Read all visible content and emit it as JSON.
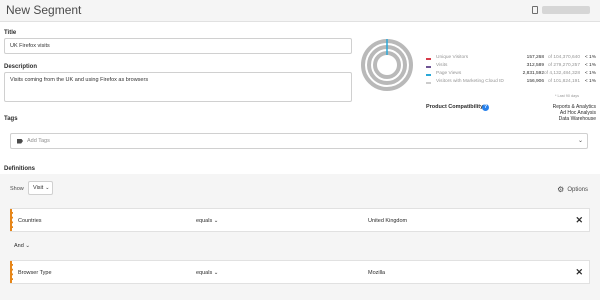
{
  "header": {
    "title": "New Segment",
    "username": ""
  },
  "form": {
    "title_label": "Title",
    "title_value": "UK Firefox visits",
    "description_label": "Description",
    "description_value": "Visits coming from the UK and using Firefox as browsers",
    "tags_label": "Tags",
    "tags_placeholder": "Add Tags"
  },
  "summary": {
    "metrics": [
      {
        "label": "Unique Visitors",
        "value": "157,268",
        "of": "of 104,370,640",
        "pct": "< 1%",
        "color": "#d73a49"
      },
      {
        "label": "Visits",
        "value": "312,589",
        "of": "of 279,270,257",
        "pct": "< 1%",
        "color": "#6e5494"
      },
      {
        "label": "Page Views",
        "value": "2,831,592",
        "of": "of 4,132,484,328",
        "pct": "< 1%",
        "color": "#2aa8d8"
      },
      {
        "label": "Visitors with Marketing Cloud ID",
        "value": "156,906",
        "of": "of 101,824,191",
        "pct": "< 1%",
        "color": "#cccccc"
      }
    ],
    "period_note": "* Last 90 days",
    "donut_ring_color": "#b9b9b9",
    "donut_highlight_color": "#2aa8d8"
  },
  "compatibility": {
    "label": "Product Compatibility",
    "products": [
      "Reports & Analytics",
      "Ad Hoc Analysis",
      "Data Warehouse"
    ]
  },
  "definitions": {
    "label": "Definitions",
    "show_label": "Show",
    "container": "Visit",
    "options_label": "Options",
    "and_label": "And",
    "accent_color": "#e68619",
    "rules": [
      {
        "dimension": "Countries",
        "operator": "equals",
        "value": "United Kingdom"
      },
      {
        "dimension": "Browser Type",
        "operator": "equals",
        "value": "Mozilla"
      }
    ]
  }
}
